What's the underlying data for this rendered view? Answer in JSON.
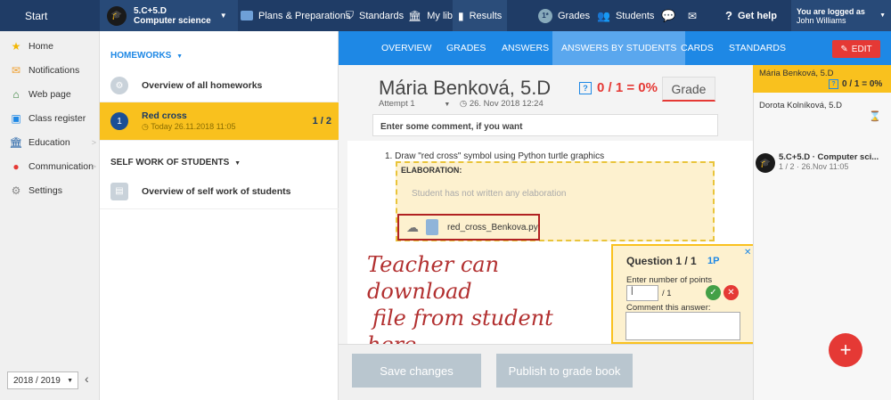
{
  "topbar": {
    "start_label": "Start",
    "class_code": "5.C+5.D",
    "class_subject": "Computer science",
    "nav": [
      "Plans & Preparations",
      "Standards",
      "My library",
      "Results",
      "Grades",
      "Students"
    ],
    "help_label": "Get help",
    "user_line1": "You are logged as",
    "user_line2": "John Williams"
  },
  "sidebar": {
    "items": [
      "Home",
      "Notifications",
      "Web page",
      "Class register",
      "Education",
      "Communication",
      "Settings"
    ],
    "year": "2018 / 2019"
  },
  "list": {
    "homeworks_header": "HOMEWORKS",
    "overview_homeworks": "Overview of all homeworks",
    "active_item": {
      "number": "1",
      "title": "Red cross",
      "date": "Today 26.11.2018 11:05",
      "progress": "1 / 2"
    },
    "selfwork_header": "SELF WORK OF STUDENTS",
    "overview_selfwork": "Overview of self work of students"
  },
  "tabs": {
    "items": [
      "OVERVIEW",
      "GRADES",
      "ANSWERS",
      "ANSWERS BY STUDENTS",
      "CARDS",
      "STANDARDS"
    ],
    "active": "ANSWERS BY STUDENTS",
    "edit_label": "EDIT"
  },
  "student": {
    "name": "Mária Benková, 5.D",
    "attempt": "Attempt 1",
    "date": "26. Nov 2018 12:24",
    "score": "0 / 1 = 0%",
    "grade_label": "Grade",
    "comment_placeholder": "Enter some comment, if you want"
  },
  "question": {
    "text": "1. Draw \"red cross\" symbol using Python turtle graphics",
    "elaboration_title": "ELABORATION:",
    "elaboration_empty": "Student has not written any elaboration",
    "file_name": "red_cross_Benkova.py"
  },
  "annotation": {
    "line1": "Teacher can download",
    "line2": "file from student here"
  },
  "points_panel": {
    "title": "Question 1 / 1",
    "points_tag": "1P",
    "points_label": "Enter number of points",
    "of_label": "/ 1",
    "comment_label": "Comment this answer:"
  },
  "bottom": {
    "save_label": "Save changes",
    "publish_label": "Publish to grade book"
  },
  "right": {
    "students": [
      {
        "name": "Mária Benková, 5.D",
        "score": "0 / 1 = 0%"
      },
      {
        "name": "Dorota Kolníková, 5.D"
      }
    ],
    "class_label": "5.C+5.D · Computer sci...",
    "class_meta": "1 / 2 · 26.Nov 11:05"
  },
  "fab_label": "+",
  "colors": {
    "topbar": "#1f3c66",
    "accent": "#1e88e5",
    "active": "#f9c11e",
    "danger": "#e53935"
  }
}
